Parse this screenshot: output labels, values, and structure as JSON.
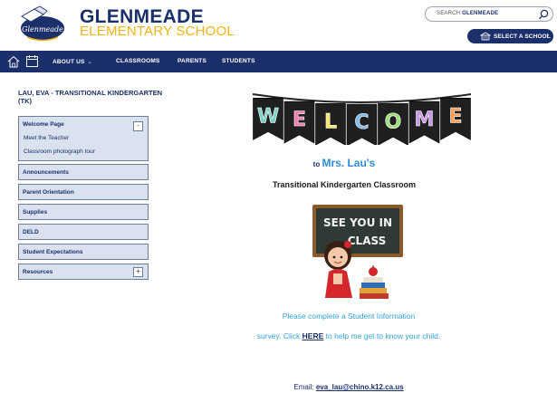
{
  "header": {
    "school_name": "GLENMEADE",
    "school_sub": "ELEMENTARY SCHOOL",
    "logo_text": "Glenmeade",
    "search_prefix": "SEARCH",
    "search_school": "GLENMEADE",
    "select_school_label": "SELECT A SCHOOL",
    "colors": {
      "navy": "#1b2f6b",
      "gold": "#f2b416"
    }
  },
  "nav": {
    "items": [
      {
        "label": "ABOUT US",
        "has_dropdown": true
      },
      {
        "label": "CLASSROOMS"
      },
      {
        "label": "PARENTS"
      },
      {
        "label": "STUDENTS"
      }
    ],
    "icons": [
      "home-icon",
      "calendar-icon"
    ]
  },
  "sidebar": {
    "title": "LAU, EVA - TRANSITIONAL KINDERGARTEN (TK)",
    "sections": [
      {
        "label": "Welcome Page",
        "toggle": "-",
        "children": [
          "Meet the Teacher",
          "Classroom photograph tour"
        ]
      },
      {
        "label": "Announcements"
      },
      {
        "label": "Parent Orientation"
      },
      {
        "label": "Supplies"
      },
      {
        "label": "DELD"
      },
      {
        "label": "Student Expectations"
      },
      {
        "label": "Resources",
        "toggle": "+"
      }
    ]
  },
  "main": {
    "banner_letters": [
      "W",
      "E",
      "L",
      "C",
      "O",
      "M",
      "E"
    ],
    "to_prefix": "to",
    "teacher_name": "Mrs. Lau's",
    "class_title": "Transitional Kindergarten Classroom",
    "chalkboard_text": [
      "SEE YOU IN",
      "CLASS"
    ],
    "info_line1": "Please complete a Student Information",
    "info_line2_pre": "survey. Click",
    "info_link": "HERE",
    "info_line2_post": "to help me get to know your child.",
    "email_label": "Email:",
    "email_address": "eva_lau@chino.k12.ca.us"
  }
}
